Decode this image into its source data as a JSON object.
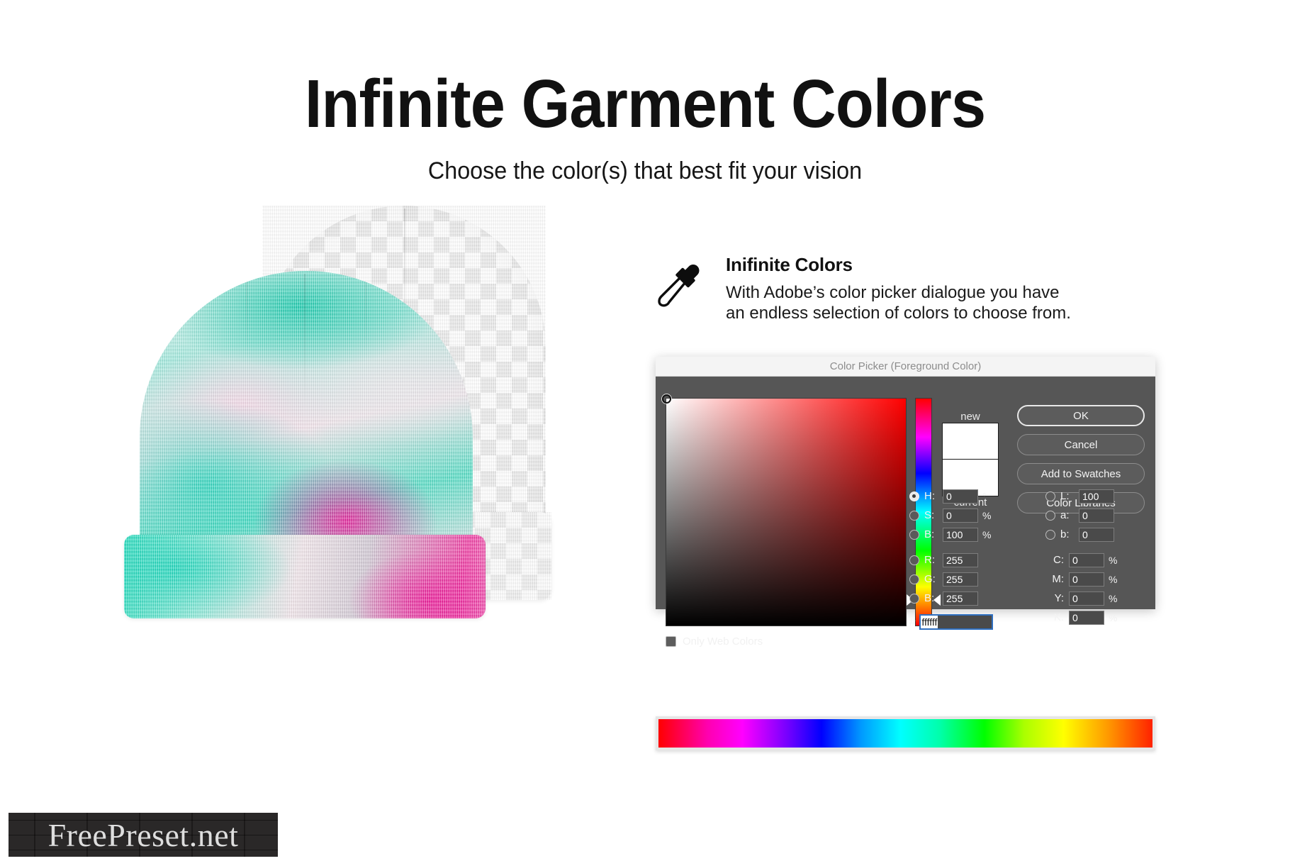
{
  "header": {
    "title": "Infinite Garment Colors",
    "subtitle": "Choose the color(s) that best fit your vision"
  },
  "feature": {
    "icon": "eyedropper-icon",
    "heading": "Inifinite Colors",
    "description": "With Adobe’s color picker dialogue you have\nan endless selection of colors to choose from."
  },
  "color_picker": {
    "title": "Color Picker (Foreground Color)",
    "swatches": {
      "new_label": "new",
      "current_label": "current",
      "new_color": "#ffffff",
      "current_color": "#ffffff"
    },
    "buttons": [
      {
        "label": "OK",
        "primary": true
      },
      {
        "label": "Cancel",
        "primary": false
      },
      {
        "label": "Add to Swatches",
        "primary": false
      },
      {
        "label": "Color Libraries",
        "primary": false
      }
    ],
    "only_web_colors": {
      "label": "Only Web Colors",
      "checked": false
    },
    "hsb": [
      {
        "name": "H",
        "label": "H:",
        "value": "0",
        "unit": "°",
        "selected": true
      },
      {
        "name": "S",
        "label": "S:",
        "value": "0",
        "unit": "%",
        "selected": false
      },
      {
        "name": "B",
        "label": "B:",
        "value": "100",
        "unit": "%",
        "selected": false
      }
    ],
    "lab": [
      {
        "name": "L",
        "label": "L:",
        "value": "100",
        "unit": "",
        "selected": false
      },
      {
        "name": "a",
        "label": "a:",
        "value": "0",
        "unit": "",
        "selected": false
      },
      {
        "name": "b",
        "label": "b:",
        "value": "0",
        "unit": "",
        "selected": false
      }
    ],
    "rgb": [
      {
        "name": "R",
        "label": "R:",
        "value": "255",
        "unit": "",
        "selected": false
      },
      {
        "name": "G",
        "label": "G:",
        "value": "255",
        "unit": "",
        "selected": false
      },
      {
        "name": "B",
        "label": "B:",
        "value": "255",
        "unit": "",
        "selected": false
      }
    ],
    "cmyk": [
      {
        "name": "C",
        "label": "C:",
        "value": "0",
        "unit": "%"
      },
      {
        "name": "M",
        "label": "M:",
        "value": "0",
        "unit": "%"
      },
      {
        "name": "Y",
        "label": "Y:",
        "value": "0",
        "unit": "%"
      },
      {
        "name": "K",
        "label": "K:",
        "value": "0",
        "unit": "%"
      }
    ],
    "hex": {
      "prefix": "#",
      "value": "ffffff",
      "selected": true
    },
    "hue_value": 0,
    "sb_cursor": {
      "saturation": 0,
      "brightness": 100
    }
  },
  "spectrum_bar": {
    "name": "color-spectrum-strip",
    "stops": [
      "#ff0000",
      "#ff00ff",
      "#0000ff",
      "#00ffff",
      "#00ff00",
      "#ffff00",
      "#ff2200"
    ]
  },
  "product": {
    "front_beanie": {
      "name": "tie-dye-beanie",
      "colors": [
        "#1bd4ba",
        "#ec1296",
        "#f0e4ea",
        "#ffffff"
      ]
    },
    "back_beanie": {
      "name": "transparent-checker-beanie",
      "colors": [
        "#ffffff",
        "#e9e9e9"
      ]
    }
  },
  "watermark": {
    "text": "FreePreset.net"
  }
}
